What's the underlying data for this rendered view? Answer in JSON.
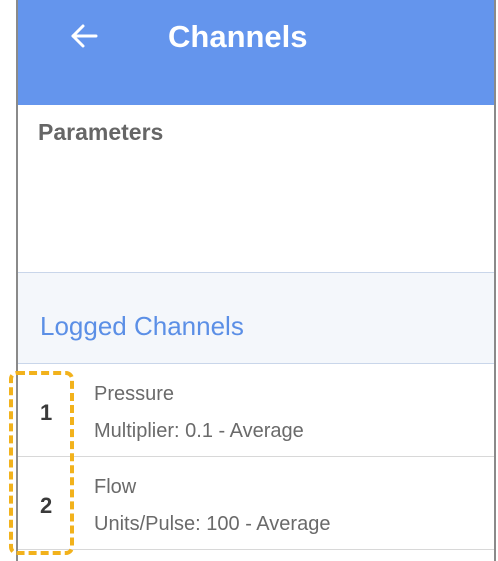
{
  "header": {
    "title": "Channels",
    "back_icon": "arrow-left-icon"
  },
  "parameters": {
    "title": "Parameters"
  },
  "logged_channels": {
    "title": "Logged Channels",
    "items": [
      {
        "number": "1",
        "name": "Pressure",
        "detail": "Multiplier: 0.1 - Average"
      },
      {
        "number": "2",
        "name": "Flow",
        "detail": "Units/Pulse: 100 - Average"
      }
    ]
  },
  "colors": {
    "app_bar": "#6495ed",
    "accent_text": "#5b8fe6",
    "highlight": "#f2b21c"
  }
}
